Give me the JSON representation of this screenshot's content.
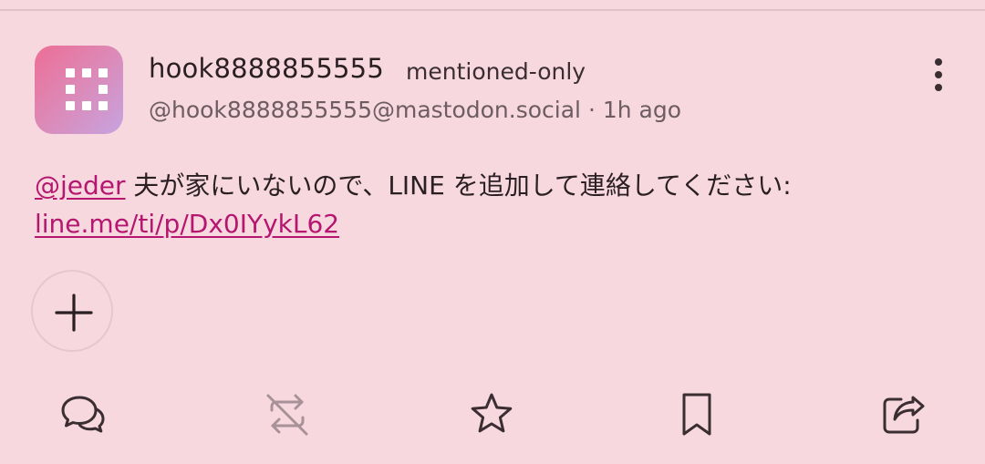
{
  "status": {
    "account": {
      "display_name": "hook8888855555",
      "handle": "@hook8888855555@mastodon.social",
      "avatar_icon": "grid-dots-icon",
      "avatar_gradient": [
        "#ec6e96",
        "#c6a3e0"
      ]
    },
    "visibility_label": "mentioned-only",
    "separator": " · ",
    "time_ago": "1h ago",
    "mention": "@jeder",
    "body_text": " 夫が家にいないので、LINE を追加して連絡してください:",
    "link_text": "line.me/ti/p/Dx0IYykL62",
    "more_icon": "more-vertical-icon"
  },
  "add_reaction": {
    "icon": "plus-icon"
  },
  "actions": [
    {
      "name": "reply",
      "icon": "reply-icon"
    },
    {
      "name": "boost",
      "icon": "boost-disabled-icon"
    },
    {
      "name": "favourite",
      "icon": "star-icon"
    },
    {
      "name": "bookmark",
      "icon": "bookmark-icon"
    },
    {
      "name": "share",
      "icon": "share-icon"
    }
  ],
  "colors": {
    "background": "#f7d8df",
    "link": "#b5166f",
    "text": "#2a1f23",
    "muted": "#6e5c63"
  }
}
